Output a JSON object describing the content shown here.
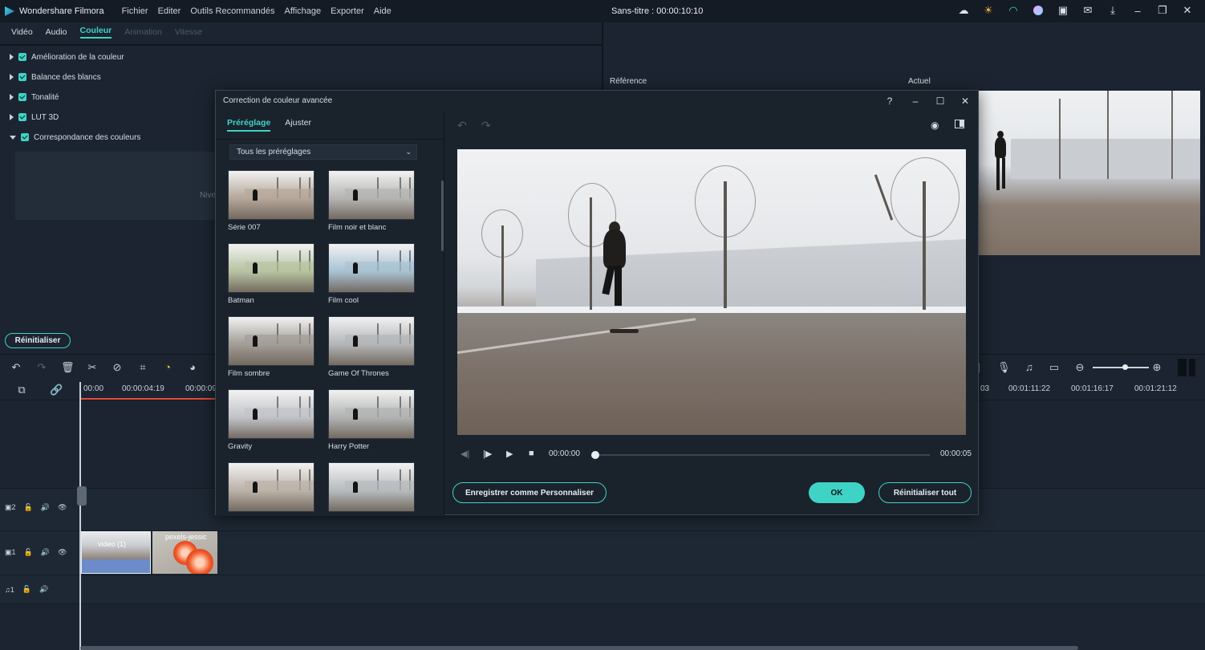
{
  "app": {
    "name": "Wondershare Filmora",
    "menu": [
      "Fichier",
      "Editer",
      "Outils Recommandés",
      "Affichage",
      "Exporter",
      "Aide"
    ],
    "doc_title": "Sans-titre : 00:00:10:10",
    "title_icons": [
      "cloud-icon",
      "sun-icon",
      "headset-icon",
      "avatar-icon",
      "save-icon",
      "mail-icon",
      "download-icon",
      "minimize-icon",
      "restore-icon",
      "close-icon"
    ]
  },
  "editor_tabs": [
    {
      "label": "Vidéo",
      "state": "normal"
    },
    {
      "label": "Audio",
      "state": "normal"
    },
    {
      "label": "Couleur",
      "state": "active"
    },
    {
      "label": "Animation",
      "state": "disabled"
    },
    {
      "label": "Vitesse",
      "state": "disabled"
    }
  ],
  "color_options": [
    {
      "label": "Amélioration de la couleur",
      "expanded": false,
      "checked": true
    },
    {
      "label": "Balance des blancs",
      "expanded": false,
      "checked": true
    },
    {
      "label": "Tonalité",
      "expanded": false,
      "checked": true
    },
    {
      "label": "LUT 3D",
      "expanded": false,
      "checked": true
    },
    {
      "label": "Correspondance des couleurs",
      "expanded": true,
      "checked": true
    }
  ],
  "panel_partial_text": "Nive",
  "reset_label": "Réinitialiser",
  "preview": {
    "reference_label": "Référence",
    "actual_label": "Actuel"
  },
  "timeline": {
    "timecodes": [
      "00:00",
      "00:00:04:19",
      "00:00:09",
      "03",
      "00:01:11:22",
      "00:01:16:17",
      "00:01:21:12"
    ],
    "tracks": [
      {
        "label": "2",
        "type": "video"
      },
      {
        "label": "1",
        "type": "video"
      },
      {
        "label": "1",
        "type": "audio"
      }
    ],
    "clips": [
      {
        "label": "video (1)"
      },
      {
        "label": "pexels-jessic"
      }
    ]
  },
  "dialog": {
    "title": "Correction de couleur avancée",
    "tabs": [
      {
        "label": "Préréglage",
        "active": true
      },
      {
        "label": "Ajuster",
        "active": false
      }
    ],
    "preset_filter": "Tous les préréglages",
    "presets": [
      {
        "name": "Série 007",
        "tint": "#b6a89a"
      },
      {
        "name": "Film noir et blanc",
        "tint": "#b5b5b3"
      },
      {
        "name": "Batman",
        "tint": "#b8c4a2"
      },
      {
        "name": "Film cool",
        "tint": "#a9c3d4"
      },
      {
        "name": "Film sombre",
        "tint": "#a39e98"
      },
      {
        "name": "Game Of Thrones",
        "tint": "#b4b6b8"
      },
      {
        "name": "Gravity",
        "tint": "#c2c4c9"
      },
      {
        "name": "Harry Potter",
        "tint": "#b2b4b4"
      },
      {
        "name": "",
        "tint": "#bcb3a9"
      },
      {
        "name": "",
        "tint": "#b8bcbf"
      }
    ],
    "time_current": "00:00:00",
    "time_end": "00:00:05",
    "progress": 0,
    "save_custom_label": "Enregistrer comme Personnaliser",
    "ok_label": "OK",
    "reset_all_label": "Réinitialiser tout"
  },
  "colors": {
    "accent": "#3fd3c6",
    "playhead_range": "#e4493d"
  }
}
